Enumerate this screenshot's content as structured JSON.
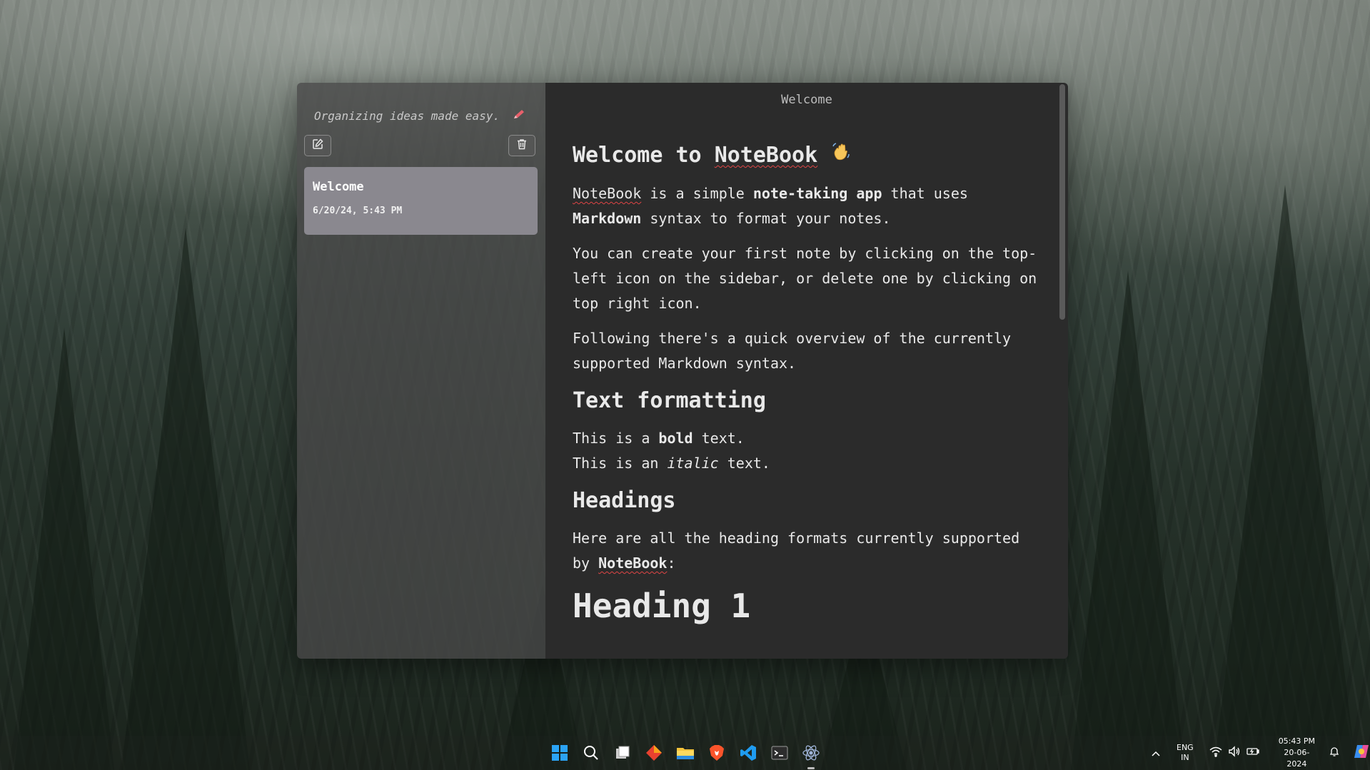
{
  "app": {
    "tagline": "Organizing ideas made easy.",
    "tagline_icon": "pen-icon",
    "new_note_icon": "new-note-icon",
    "delete_icon": "trash-icon",
    "note_card": {
      "title": "Welcome",
      "date": "6/20/24, 5:43 PM"
    },
    "editor": {
      "title": "Welcome",
      "heading1": "Welcome to NoteBook",
      "wave_icon": "waving-hand-icon",
      "intro": {
        "brand": "NoteBook",
        "t1": " is a simple ",
        "bold1": "note-taking app",
        "t2": " that uses ",
        "bold2": "Markdown",
        "t3": " syntax to format your notes."
      },
      "p2": "You can create your first note by clicking on the top-left icon on the sidebar, or delete one by clicking on top right icon.",
      "p3": "Following there's a quick overview of the currently supported Markdown syntax.",
      "h_text_formatting": "Text formatting",
      "bold_line": {
        "pre": "This is a ",
        "bold": "bold",
        "post": " text."
      },
      "italic_line": {
        "pre": "This is an ",
        "italic": "italic",
        "post": " text."
      },
      "h_headings": "Headings",
      "headings_para": {
        "pre": "Here are all the heading formats currently supported by ",
        "brand": "NoteBook",
        "post": ":"
      },
      "h_heading1": "Heading 1"
    }
  },
  "colors": {
    "sidebar_bg": "#484848",
    "editor_bg": "#2b2b2b",
    "card_bg": "#8a888f",
    "spell_underline": "#e04545"
  },
  "taskbar": {
    "icons": [
      "windows-start-icon",
      "search-icon",
      "task-view-icon",
      "diamond-app-icon",
      "file-explorer-icon",
      "brave-browser-icon",
      "vscode-icon",
      "terminal-icon",
      "electron-app-icon"
    ],
    "tray": {
      "lang_line1": "ENG",
      "lang_line2": "IN",
      "time": "05:43 PM",
      "date": "20-06-2024"
    }
  }
}
